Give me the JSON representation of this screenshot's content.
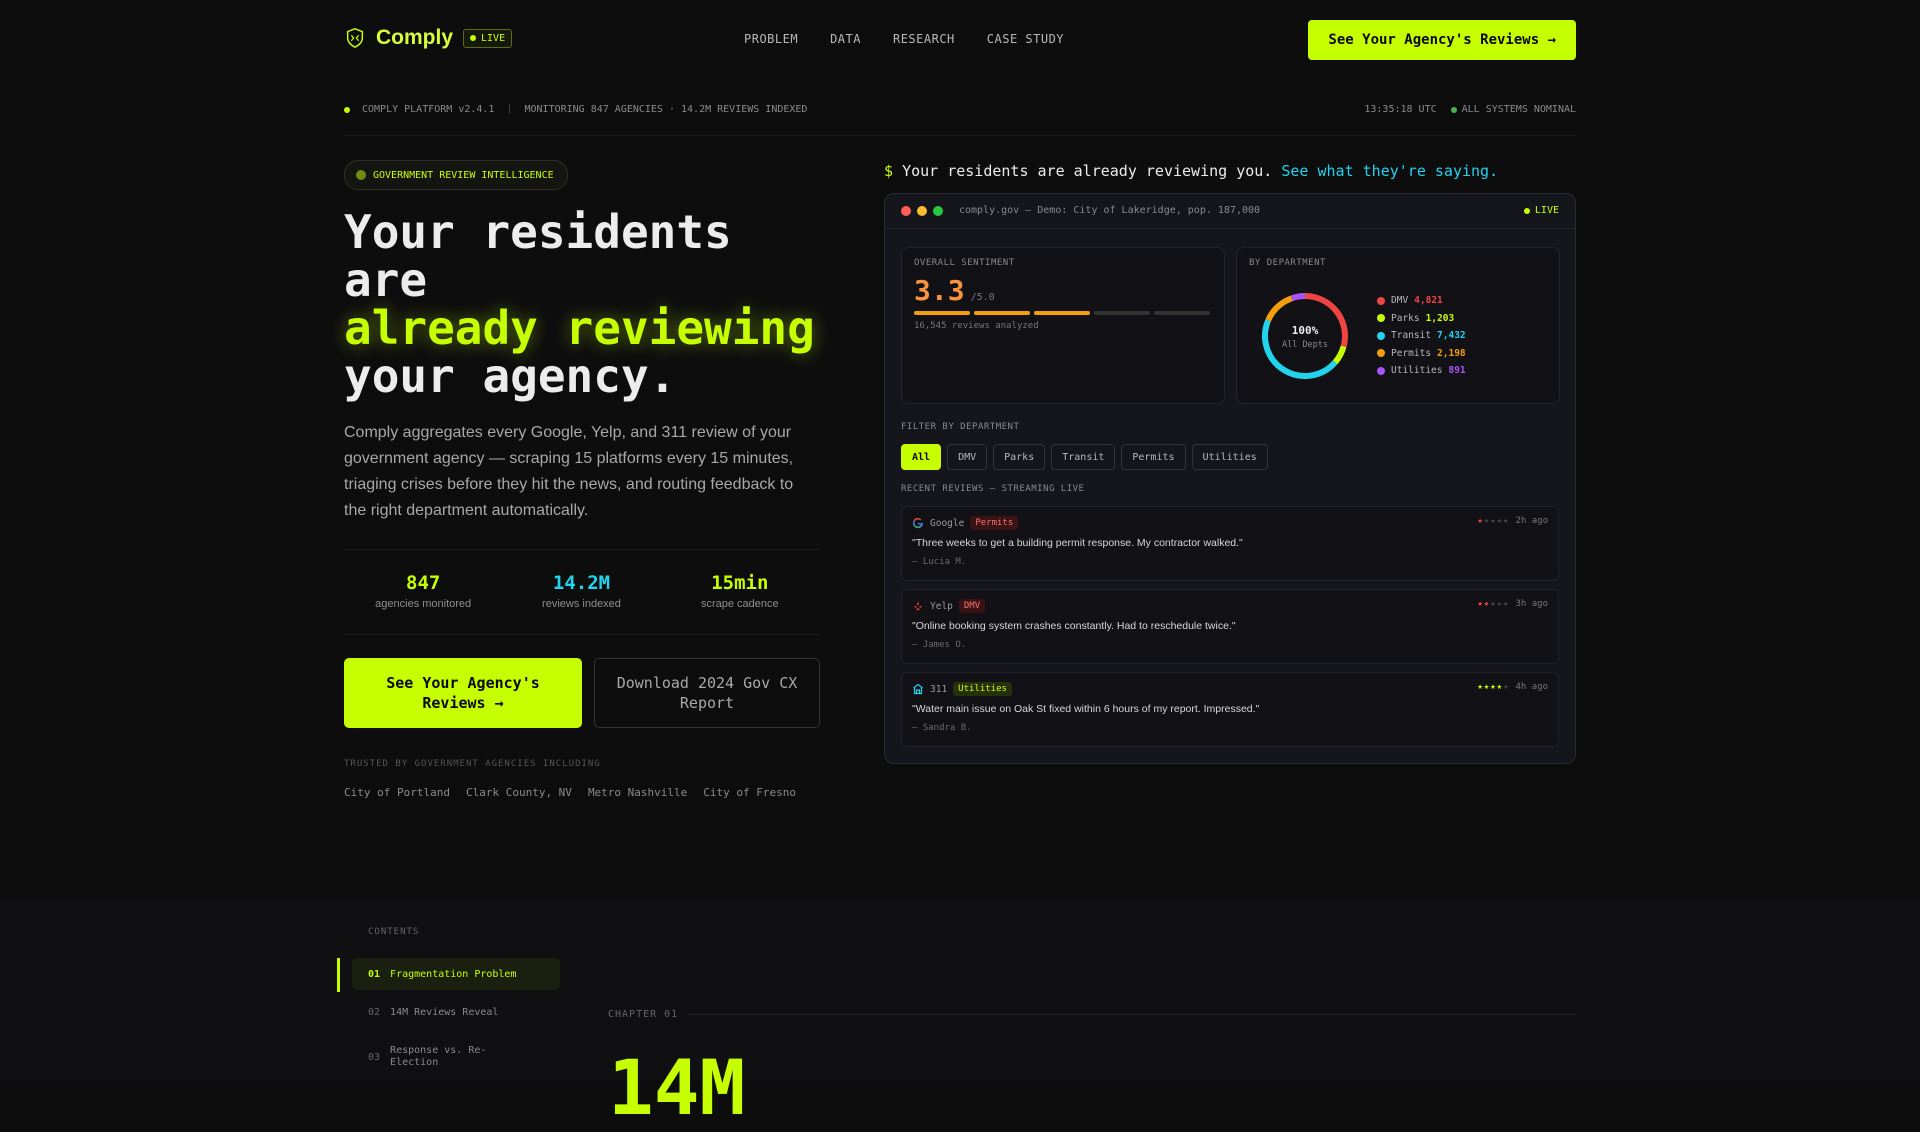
{
  "nav": {
    "brand": "Comply",
    "live": "LIVE",
    "links": [
      "PROBLEM",
      "DATA",
      "RESEARCH",
      "CASE STUDY"
    ],
    "cta": "See Your Agency's Reviews →"
  },
  "status": {
    "platform": "COMPLY PLATFORM v2.4.1",
    "monitoring": "MONITORING 847 AGENCIES · 14.2M REVIEWS INDEXED",
    "time": "13:35:18 UTC",
    "systems": "ALL SYSTEMS NOMINAL"
  },
  "hero": {
    "pill": "GOVERNMENT REVIEW INTELLIGENCE",
    "headline_1": "Your residents",
    "headline_2": "are",
    "headline_3": "already reviewing",
    "headline_4": "your agency.",
    "description": "Comply aggregates every Google, Yelp, and 311 review of your government agency — scraping 15 platforms every 15 minutes, triaging crises before they hit the news, and routing feedback to the right department automatically.",
    "stats": [
      {
        "value": "847",
        "label": "agencies monitored",
        "color": "#c6ff00"
      },
      {
        "value": "14.2M",
        "label": "reviews indexed",
        "color": "#22d3ee"
      },
      {
        "value": "15min",
        "label": "scrape cadence",
        "color": "#c6ff00"
      }
    ],
    "cta_primary_1": "See Your Agency's",
    "cta_primary_2": "Reviews →",
    "cta_secondary_1": "Download 2024 Gov CX",
    "cta_secondary_2": "Report",
    "trusted_label": "TRUSTED BY GOVERNMENT AGENCIES INCLUDING",
    "clients": [
      "City of Portland",
      "Clark County, NV",
      "Metro Nashville",
      "City of Fresno"
    ]
  },
  "demo": {
    "prompt_dollar": "$",
    "prompt_text": "Your residents are already reviewing you.",
    "prompt_link": "See what they're saying.",
    "window_title": "comply.gov — Demo: City of Lakeridge, pop. 187,000",
    "window_live": "LIVE",
    "sentiment_label": "OVERALL SENTIMENT",
    "sentiment_value": "3.3",
    "sentiment_of": "/5.0",
    "sentiment_fraction": 0.66,
    "reviews_analyzed": "16,545 reviews analyzed",
    "dept_label": "BY DEPARTMENT",
    "donut_pct": "100%",
    "donut_sub": "All Depts",
    "departments": [
      {
        "name": "DMV",
        "count": "4,821",
        "color": "#ef4444",
        "value": 4821
      },
      {
        "name": "Parks",
        "count": "1,203",
        "color": "#c6ff00",
        "value": 1203
      },
      {
        "name": "Transit",
        "count": "7,432",
        "color": "#22d3ee",
        "value": 7432
      },
      {
        "name": "Permits",
        "count": "2,198",
        "color": "#f59e0b",
        "value": 2198
      },
      {
        "name": "Utilities",
        "count": "891",
        "color": "#a855f7",
        "value": 891
      }
    ],
    "filter_label": "FILTER BY DEPARTMENT",
    "filters": [
      "All",
      "DMV",
      "Parks",
      "Transit",
      "Permits",
      "Utilities"
    ],
    "recent_label": "RECENT REVIEWS — STREAMING LIVE",
    "reviews": [
      {
        "source": "Google",
        "icon": "google-icon",
        "tag": "Permits",
        "rating": 1,
        "time": "2h ago",
        "text": "\"Three weeks to get a building permit response. My contractor walked.\"",
        "author": "— Lucia M."
      },
      {
        "source": "Yelp",
        "icon": "yelp-icon",
        "tag": "DMV",
        "rating": 2,
        "time": "3h ago",
        "text": "\"Online booking system crashes constantly. Had to reschedule twice.\"",
        "author": "— James O."
      },
      {
        "source": "311",
        "icon": "city-hall-icon",
        "tag": "Utilities",
        "rating": 4,
        "time": "4h ago",
        "text": "\"Water main issue on Oak St fixed within 6 hours of my report. Impressed.\"",
        "author": "— Sandra B."
      }
    ]
  },
  "contents": {
    "label": "CONTENTS",
    "items": [
      {
        "num": "01",
        "label": "Fragmentation Problem"
      },
      {
        "num": "02",
        "label": "14M Reviews Reveal"
      },
      {
        "num": "03",
        "label_1": "Response vs. Re-",
        "label_2": "Election"
      }
    ],
    "chapter": "CHAPTER 01",
    "big_number": "14M"
  }
}
